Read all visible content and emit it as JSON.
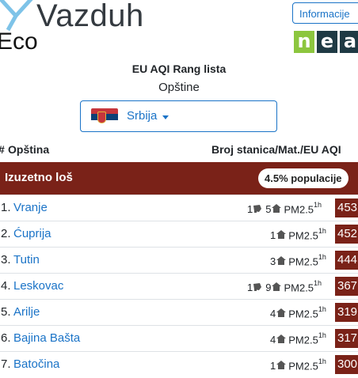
{
  "brand": {
    "name": "Vazduh",
    "sub": "Eco",
    "colors": {
      "accent": "#1a73c7",
      "band": "#7a2218"
    }
  },
  "header": {
    "info_button": "Informacije",
    "partner_logo_letters": [
      "n",
      "e",
      "a"
    ]
  },
  "page": {
    "title": "EU AQI Rang lista",
    "subtitle": "Opštine"
  },
  "country_select": {
    "label": "Srbija",
    "flag_icon": "serbia-flag-icon"
  },
  "table": {
    "headers": {
      "num": "#",
      "opstina": "Opština",
      "right": "Broj stanica/Mat./EU AQI"
    },
    "category": {
      "label": "Izuzetno loš",
      "population": "4.5% populacije"
    },
    "rows": [
      {
        "rank": "1.",
        "name": "Vranje",
        "cams": "1",
        "stations": "5",
        "pollutant": "PM2.5",
        "period": "1h",
        "aqi": "453"
      },
      {
        "rank": "2.",
        "name": "Ćuprija",
        "cams": "",
        "stations": "1",
        "pollutant": "PM2.5",
        "period": "1h",
        "aqi": "452"
      },
      {
        "rank": "3.",
        "name": "Tutin",
        "cams": "",
        "stations": "3",
        "pollutant": "PM2.5",
        "period": "1h",
        "aqi": "444"
      },
      {
        "rank": "4.",
        "name": "Leskovac",
        "cams": "1",
        "stations": "9",
        "pollutant": "PM2.5",
        "period": "1h",
        "aqi": "367"
      },
      {
        "rank": "5.",
        "name": "Arilje",
        "cams": "",
        "stations": "4",
        "pollutant": "PM2.5",
        "period": "1h",
        "aqi": "319"
      },
      {
        "rank": "6.",
        "name": "Bajina Bašta",
        "cams": "",
        "stations": "4",
        "pollutant": "PM2.5",
        "period": "1h",
        "aqi": "317"
      },
      {
        "rank": "7.",
        "name": "Batočina",
        "cams": "",
        "stations": "1",
        "pollutant": "PM2.5",
        "period": "1h",
        "aqi": "300"
      }
    ]
  }
}
